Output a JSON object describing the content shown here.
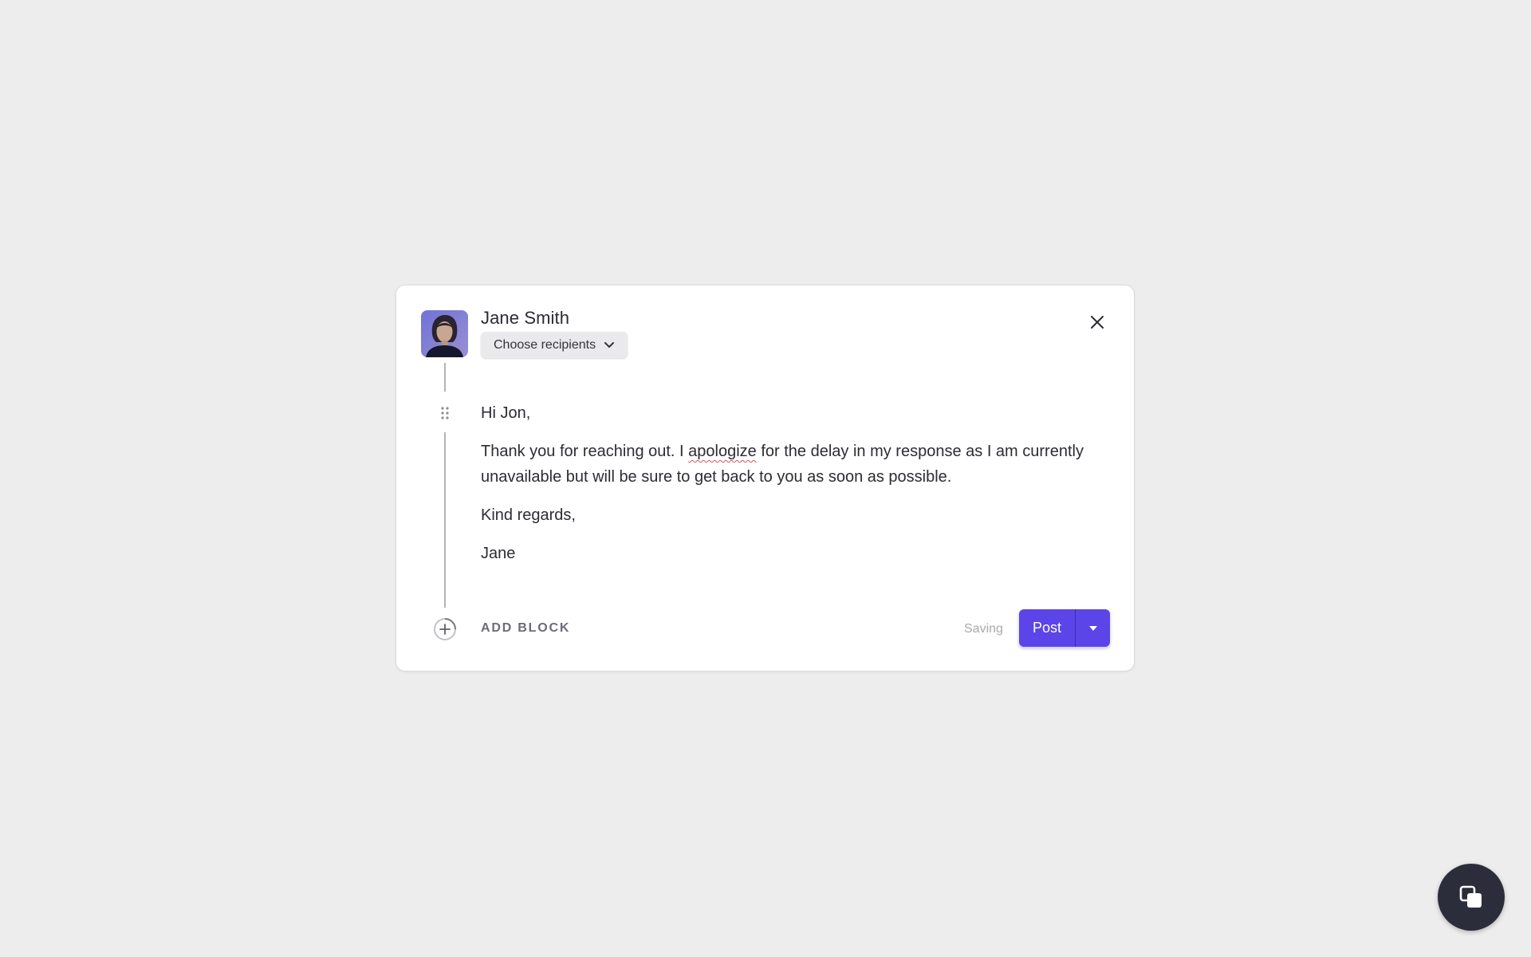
{
  "composer": {
    "author_name": "Jane Smith",
    "recipients_label": "Choose recipients",
    "message": {
      "greeting": "Hi Jon,",
      "line1_before": "Thank you for reaching out. I ",
      "line1_misspelled": "apologize",
      "line1_after": " for the delay in my response as I am currently unavailable but will be sure to get back to you as soon as possible.",
      "closing": "Kind regards,",
      "signature": "Jane"
    },
    "add_block_label": "ADD BLOCK",
    "status_text": "Saving",
    "post_label": "Post"
  },
  "icons": {
    "close": "close-icon",
    "recipients_dropdown": "chevron-down-icon",
    "drag": "drag-handle-icon",
    "add": "plus-circle-icon",
    "post_options": "caret-down-icon",
    "fab": "copy-icon"
  },
  "colors": {
    "accent": "#5b45e8",
    "background": "#ededee",
    "fab": "#2b2d3a",
    "spellcheck": "#e05252"
  }
}
